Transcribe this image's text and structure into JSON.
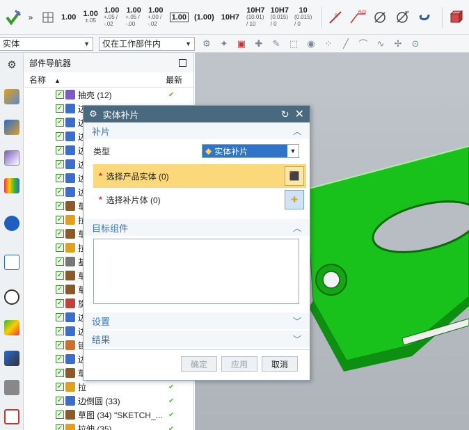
{
  "toolbar": {
    "tolerances": [
      {
        "kind": "plain",
        "main": "1.00"
      },
      {
        "kind": "stack",
        "main": "1.00",
        "sub": "±.05"
      },
      {
        "kind": "stack",
        "main": "1.00",
        "sub": "+.05 / -.02"
      },
      {
        "kind": "stack",
        "main": "1.00",
        "sub": "+.05 / -.00"
      },
      {
        "kind": "stack",
        "main": "1.00",
        "sub": "+.00 / -.02"
      },
      {
        "kind": "box",
        "main": "1.00"
      },
      {
        "kind": "plain",
        "main": "(1.00)"
      },
      {
        "kind": "plain",
        "main": "10H7"
      },
      {
        "kind": "stack",
        "main": "10H7",
        "sub": "(10.01) / 10"
      },
      {
        "kind": "stack",
        "main": "10H7",
        "sub": "(0.015) / 0"
      },
      {
        "kind": "stack",
        "main": "10",
        "sub": "(0.015) / 0"
      }
    ],
    "selection_filter": "实体",
    "selection_scope": "仅在工作部件内"
  },
  "navigator": {
    "title": "部件导航器",
    "col_name": "名称",
    "col_new": "最新",
    "rows": [
      {
        "label": "抽壳 (12)",
        "icon_color": "#7c5cc4"
      },
      {
        "label": "边",
        "icon_color": "#3b6fc9"
      },
      {
        "label": "边",
        "icon_color": "#3b6fc9"
      },
      {
        "label": "边",
        "icon_color": "#3b6fc9"
      },
      {
        "label": "边",
        "icon_color": "#3b6fc9"
      },
      {
        "label": "边",
        "icon_color": "#3b6fc9"
      },
      {
        "label": "边",
        "icon_color": "#3b6fc9"
      },
      {
        "label": "边",
        "icon_color": "#3b6fc9"
      },
      {
        "label": "草",
        "icon_color": "#8a5a2b"
      },
      {
        "label": "拉",
        "icon_color": "#e0a020"
      },
      {
        "label": "草",
        "icon_color": "#8a5a2b"
      },
      {
        "label": "拉",
        "icon_color": "#e0a020"
      },
      {
        "label": "基",
        "icon_color": "#777777"
      },
      {
        "label": "草",
        "icon_color": "#8a5a2b"
      },
      {
        "label": "草",
        "icon_color": "#8a5a2b"
      },
      {
        "label": "旋",
        "icon_color": "#c04040"
      },
      {
        "label": "边",
        "icon_color": "#3b6fc9"
      },
      {
        "label": "边",
        "icon_color": "#3b6fc9"
      },
      {
        "label": "镜",
        "icon_color": "#d07030"
      },
      {
        "label": "边",
        "icon_color": "#3b6fc9"
      },
      {
        "label": "草",
        "icon_color": "#8a5a2b"
      },
      {
        "label": "拉",
        "icon_color": "#e0a020"
      },
      {
        "label": "边倒圆 (33)",
        "icon_color": "#3b6fc9"
      },
      {
        "label": "草图 (34) \"SKETCH_...",
        "icon_color": "#8a5a2b"
      },
      {
        "label": "拉伸 (35)",
        "icon_color": "#e0a020"
      }
    ]
  },
  "dialog": {
    "title": "实体补片",
    "section_patch": "补片",
    "type_label": "类型",
    "type_value": "实体补片",
    "select_product_body": "选择产品实体 (0)",
    "select_patch_body": "选择补片体 (0)",
    "section_target": "目标组件",
    "section_settings": "设置",
    "section_results": "结果",
    "btn_ok": "确定",
    "btn_apply": "应用",
    "btn_cancel": "取消"
  },
  "colors": {
    "part_green": "#19c21a",
    "dialog_title_bg": "#49697f",
    "section_blue": "#3a78b8",
    "highlight_row": "#fbd97a"
  }
}
